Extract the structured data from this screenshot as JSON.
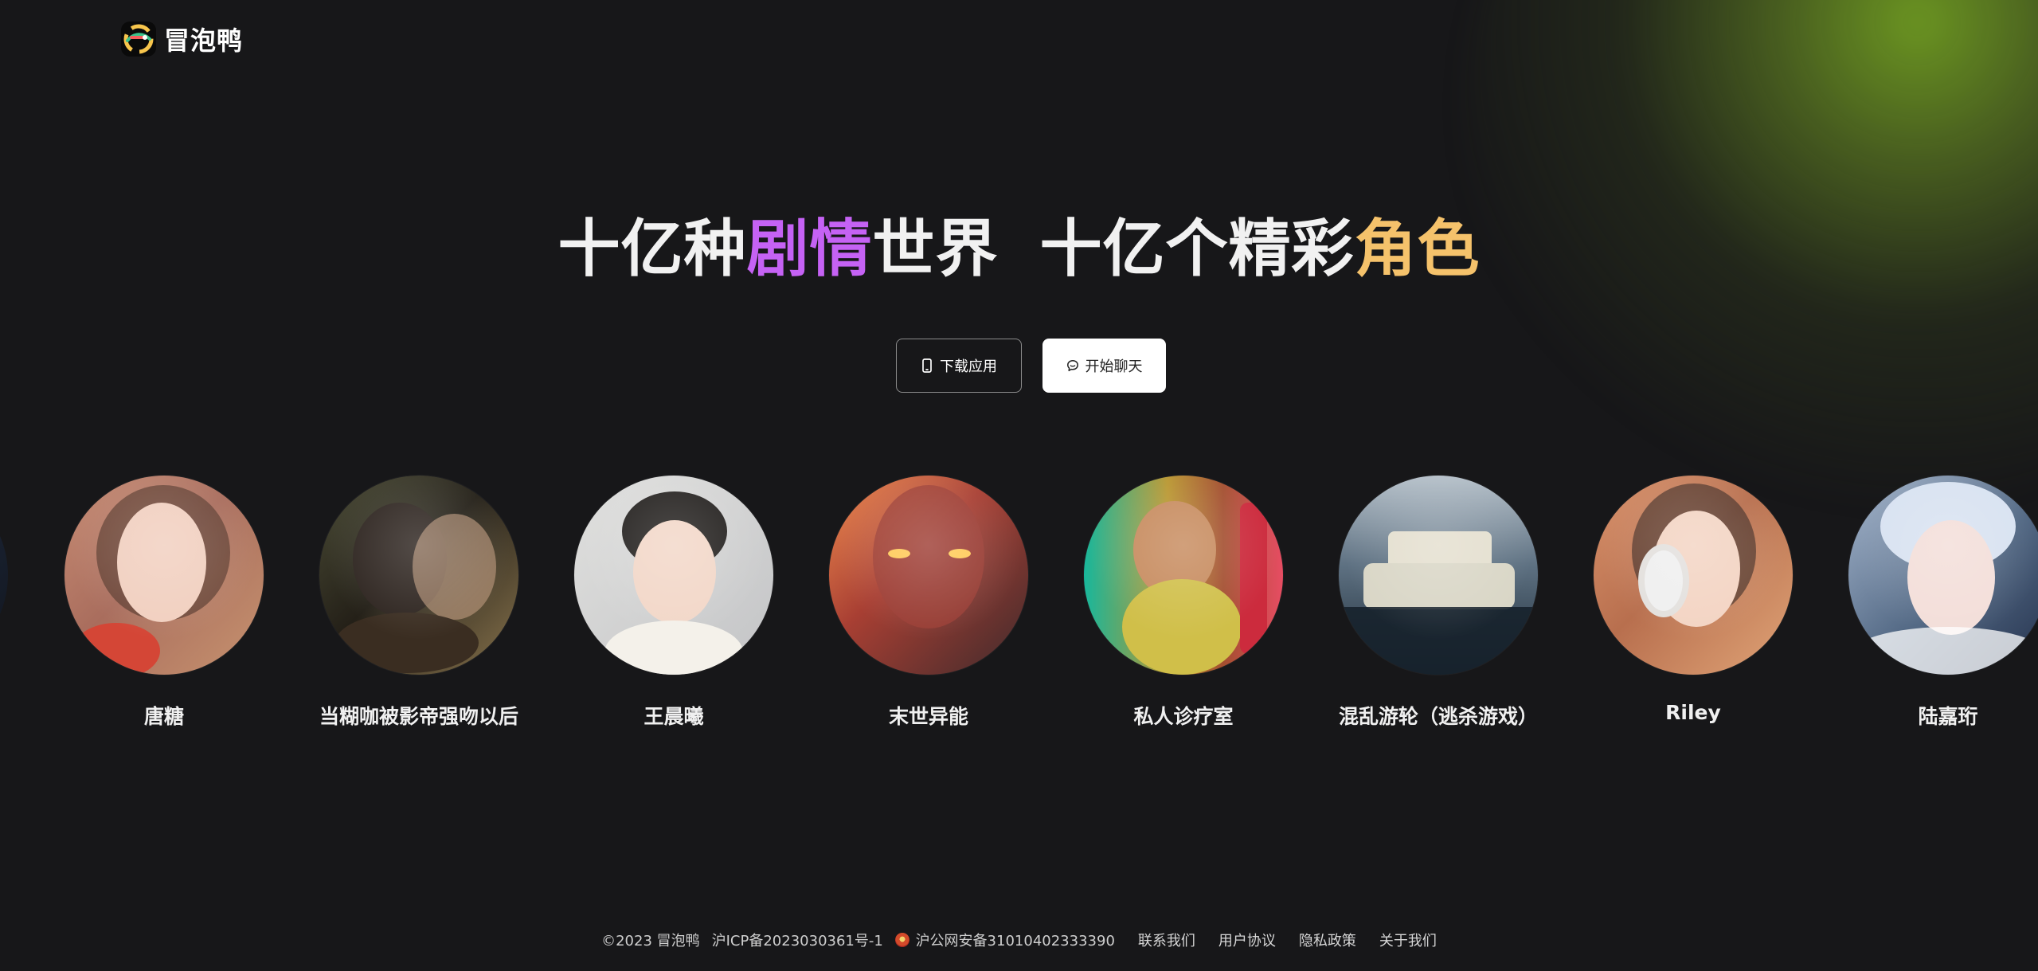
{
  "app": {
    "name": "冒泡鸭"
  },
  "hero": {
    "title_part_1": "十亿种",
    "title_part_2": "剧情",
    "title_part_3": "世界",
    "title_part_4": "十亿个精彩",
    "title_part_5": "角色"
  },
  "actions": {
    "download_label": "下载应用",
    "chat_label": "开始聊天"
  },
  "characters": [
    {
      "name": "唐糖",
      "icon": "avatar-portrait"
    },
    {
      "name": "当糊咖被影帝强吻以后",
      "icon": "avatar-couple"
    },
    {
      "name": "王晨曦",
      "icon": "avatar-portrait"
    },
    {
      "name": "末世异能",
      "icon": "avatar-apocalypse"
    },
    {
      "name": "私人诊疗室",
      "icon": "avatar-portrait"
    },
    {
      "name": "混乱游轮（逃杀游戏）",
      "icon": "avatar-ship"
    },
    {
      "name": "Riley",
      "icon": "avatar-portrait"
    },
    {
      "name": "陆嘉珩",
      "icon": "avatar-portrait"
    }
  ],
  "footer": {
    "copyright": "©2023 冒泡鸭",
    "icp": "沪ICP备2023030361号-1",
    "police_record": "沪公网安备31010402333390",
    "links": [
      "联系我们",
      "用户协议",
      "隐私政策",
      "关于我们"
    ]
  },
  "colors": {
    "background": "#171719",
    "accent_purple": "#c562f4",
    "accent_gold": "#f5c26b",
    "glow_green": "#6f9b23"
  }
}
